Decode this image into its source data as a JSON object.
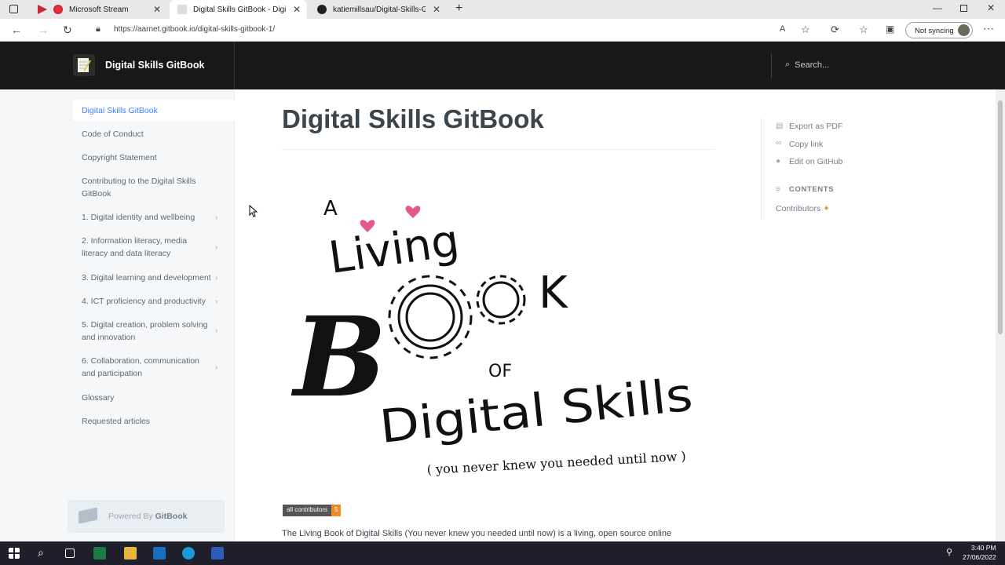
{
  "browser": {
    "tabs": [
      {
        "label": "Microsoft Stream",
        "active": false
      },
      {
        "label": "Digital Skills GitBook - Digital Sk",
        "active": true
      },
      {
        "label": "katiemillsau/Digital-Skills-GitBo",
        "active": false
      }
    ],
    "url": "https://aarnet.gitbook.io/digital-skills-gitbook-1/",
    "profile_label": "Not syncing"
  },
  "header": {
    "site_title": "Digital Skills GitBook",
    "search_placeholder": "Search..."
  },
  "sidebar": {
    "items": [
      {
        "label": "Digital Skills GitBook",
        "active": true
      },
      {
        "label": "Code of Conduct"
      },
      {
        "label": "Copyright Statement"
      },
      {
        "label": "Contributing to the Digital Skills GitBook"
      },
      {
        "label": "1. Digital identity and wellbeing",
        "expandable": true
      },
      {
        "label": "2. Information literacy, media literacy and data literacy",
        "expandable": true
      },
      {
        "label": "3. Digital learning and development",
        "expandable": true
      },
      {
        "label": "4. ICT proficiency and productivity",
        "expandable": true
      },
      {
        "label": "5. Digital creation, problem solving and innovation",
        "expandable": true
      },
      {
        "label": "6. Collaboration, communication and participation",
        "expandable": true
      },
      {
        "label": "Glossary"
      },
      {
        "label": "Requested articles"
      }
    ],
    "powered_prefix": "Powered By",
    "powered_brand": "GitBook"
  },
  "main": {
    "title": "Digital Skills GitBook",
    "hero": {
      "line_a": "A",
      "line_living": "Living",
      "line_b": "B",
      "line_k": "K",
      "line_of": "OF",
      "line_digital": "Digital Skills",
      "line_sub": "( you never knew you needed until now )"
    },
    "badge_left": "all contributors",
    "badge_right": "5",
    "intro": "The Living Book of Digital Skills (You never knew you needed until now) is a living, open source online"
  },
  "toc": {
    "export_pdf": "Export as PDF",
    "copy_link": "Copy link",
    "edit_github": "Edit on GitHub",
    "contents_label": "CONTENTS",
    "contributors": "Contributors"
  },
  "taskbar": {
    "time": "3:40 PM",
    "date": "27/06/2022"
  },
  "colors": {
    "accent": "#3884ff",
    "header_bg": "#181818",
    "sidebar_bg": "#f5f7f9"
  }
}
